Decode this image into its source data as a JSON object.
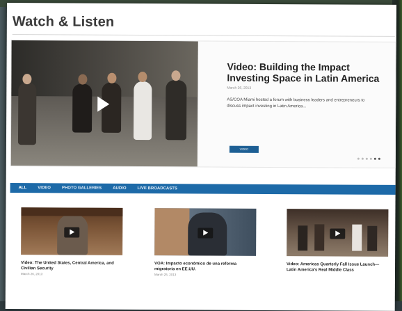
{
  "page": {
    "title": "Watch & Listen"
  },
  "featured": {
    "title": "Video: Building the Impact Investing Space in Latin America",
    "date": "March 26, 2013",
    "description": "AS/COA Miami hosted a forum with business leaders and entrepreneurs to discuss impact investing in Latin America...",
    "button_label": "VIDEO",
    "dots_count": 6,
    "active_dot": 4
  },
  "filters": [
    "All",
    "Video",
    "Photo Galleries",
    "Audio",
    "Live Broadcasts"
  ],
  "cards": [
    {
      "title": "Video: The United States, Central America, and Civilian Security",
      "date": "March 26, 2013"
    },
    {
      "title": "VOA: Impacto económico de una reforma migratoria en EE.UU.",
      "date": "March 25, 2013"
    },
    {
      "title": "Video: Americas Quarterly Fall Issue Launch—Latin America's Real Middle Class",
      "date": ""
    }
  ],
  "colors": {
    "nav_blue": "#1d6aa8",
    "button_blue": "#1d5f94"
  }
}
